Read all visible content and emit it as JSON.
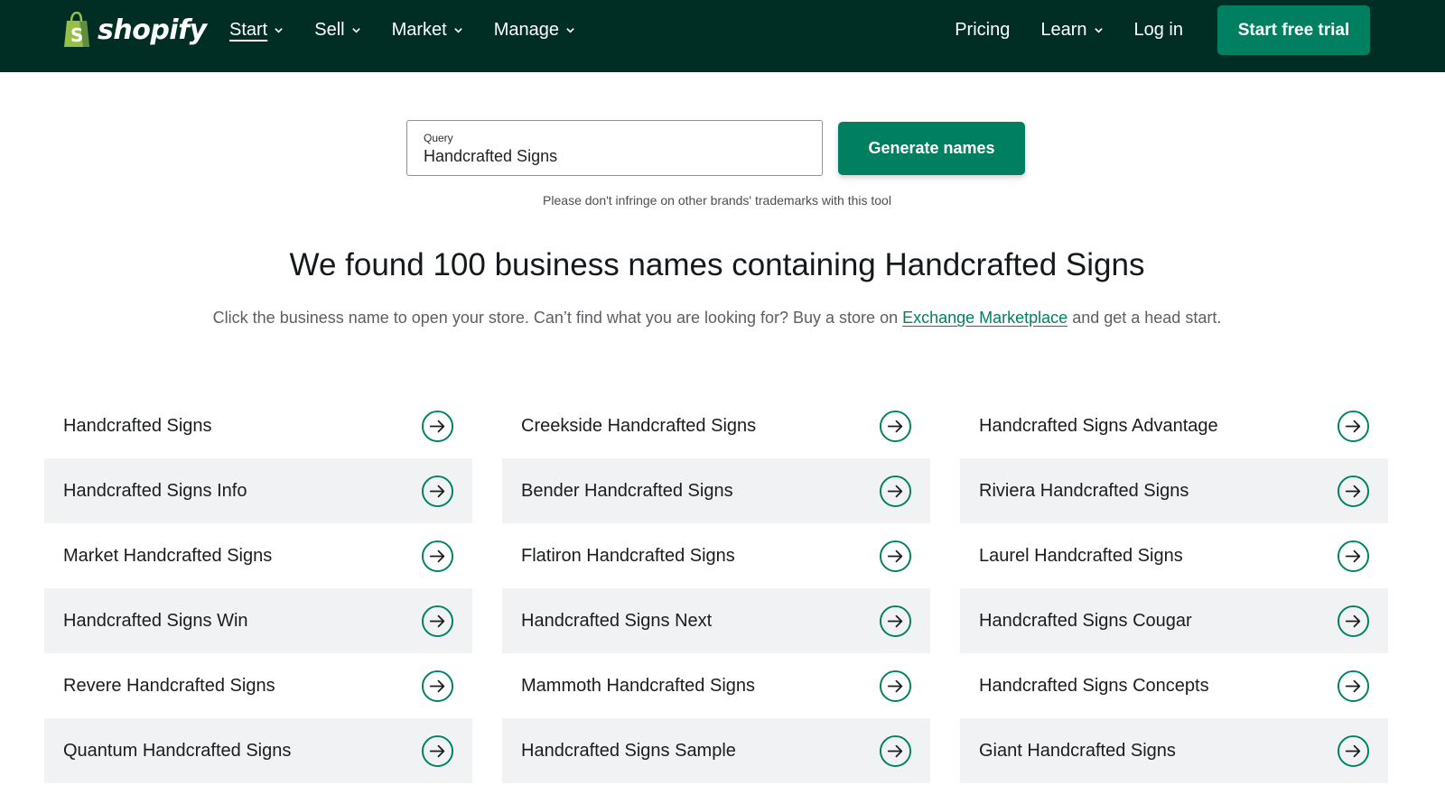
{
  "brand": {
    "name": "shopify",
    "colors": {
      "nav_bg": "#002e25",
      "accent": "#008060",
      "bag_green": "#95bf47"
    }
  },
  "nav": {
    "left_items": [
      {
        "label": "Start",
        "active": true,
        "has_dropdown": true
      },
      {
        "label": "Sell",
        "active": false,
        "has_dropdown": true
      },
      {
        "label": "Market",
        "active": false,
        "has_dropdown": true
      },
      {
        "label": "Manage",
        "active": false,
        "has_dropdown": true
      }
    ],
    "pricing": "Pricing",
    "learn": "Learn",
    "login": "Log in",
    "cta": "Start free trial"
  },
  "search": {
    "label": "Query",
    "value": "Handcrafted Signs",
    "button": "Generate names",
    "disclaimer": "Please don't infringe on other brands' trademarks with this tool"
  },
  "results": {
    "headline": "We found 100 business names containing Handcrafted Signs",
    "sub_before": "Click the business name to open your store. Can’t find what you are looking for? Buy a store on ",
    "sub_link": "Exchange Marketplace",
    "sub_after": " and get a head start.",
    "columns": [
      [
        "Handcrafted Signs",
        "Handcrafted Signs Info",
        "Market Handcrafted Signs",
        "Handcrafted Signs Win",
        "Revere Handcrafted Signs",
        "Quantum Handcrafted Signs"
      ],
      [
        "Creekside Handcrafted Signs",
        "Bender Handcrafted Signs",
        "Flatiron Handcrafted Signs",
        "Handcrafted Signs Next",
        "Mammoth Handcrafted Signs",
        "Handcrafted Signs Sample"
      ],
      [
        "Handcrafted Signs Advantage",
        "Riviera Handcrafted Signs",
        "Laurel Handcrafted Signs",
        "Handcrafted Signs Cougar",
        "Handcrafted Signs Concepts",
        "Giant Handcrafted Signs"
      ]
    ],
    "row_icon": "arrow-right-circle-icon"
  }
}
